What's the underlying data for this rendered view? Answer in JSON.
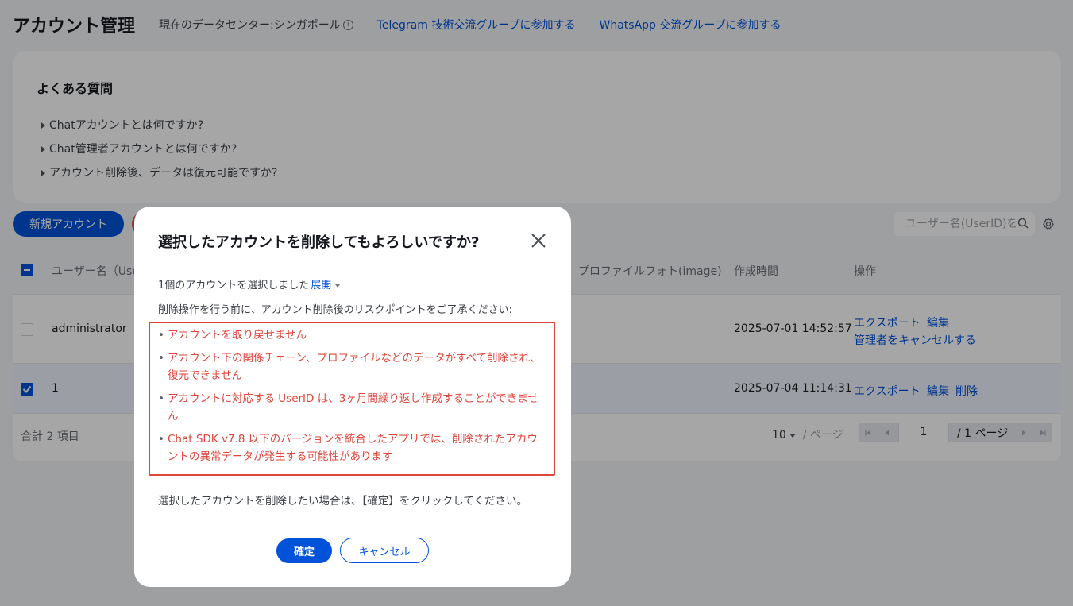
{
  "header": {
    "title": "アカウント管理",
    "datacenter": "現在のデータセンター:シンガポール",
    "links": [
      "Telegram 技術交流グループに参加する",
      "WhatsApp 交流グループに参加する"
    ]
  },
  "faq": {
    "title": "よくある質問",
    "items": [
      "Chatアカウントとは何ですか?",
      "Chat管理者アカウントとは何ですか?",
      "アカウント削除後、データは復元可能ですか?"
    ]
  },
  "toolbar": {
    "new_account": "新規アカウント",
    "search_placeholder": "ユーザー名(UserID)を検"
  },
  "table": {
    "columns": {
      "username": "ユーザー名（UserID）",
      "profile_photo": "プロファイルフォト(image)",
      "created": "作成時間",
      "actions": "操作"
    },
    "rows": [
      {
        "username": "administrator",
        "created": "2025-07-01 14:52:57",
        "actions": [
          "エクスポート",
          "編集",
          "管理者をキャンセルする"
        ],
        "checked": false
      },
      {
        "username": "1",
        "created": "2025-07-04 11:14:31",
        "actions": [
          "エクスポート",
          "編集",
          "削除"
        ],
        "checked": true
      }
    ],
    "total": "合計 2 項目",
    "page_size": "10",
    "page_size_unit": "/ ページ",
    "current_page": "1",
    "total_pages": "/ 1 ページ"
  },
  "modal": {
    "title": "選択したアカウントを削除してもよろしいですか?",
    "selected_text": "1個のアカウントを選択しました",
    "expand": "展開",
    "intro": "削除操作を行う前に、アカウント削除後のリスクポイントをご了承ください:",
    "risks": [
      "アカウントを取り戻せません",
      "アカウント下の関係チェーン、プロファイルなどのデータがすべて削除され、復元できません",
      "アカウントに対応する UserID は、3ヶ月間繰り返し作成することができません",
      "Chat SDK v7.8 以下のバージョンを統合したアプリでは、削除されたアカウントの異常データが発生する可能性があります"
    ],
    "confirm_text": "選択したアカウントを削除したい場合は、【確定】をクリックしてください。",
    "ok": "確定",
    "cancel": "キャンセル"
  },
  "colors": {
    "accent": "#0052d9",
    "danger": "#e0453a",
    "background": "#f3f4f7"
  }
}
